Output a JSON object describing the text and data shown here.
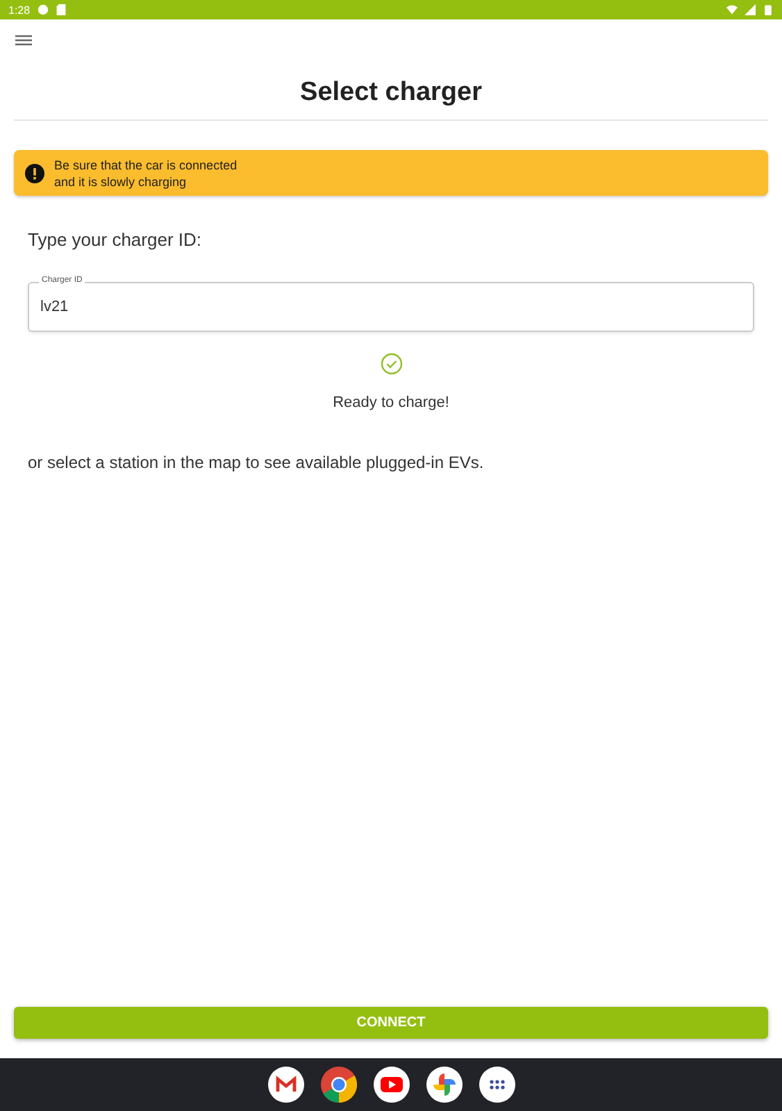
{
  "status_bar": {
    "time": "1:28"
  },
  "title": "Select charger",
  "alert": {
    "lines": [
      "Be sure that the car is connected",
      "and it is slowly charging"
    ]
  },
  "prompt": "Type your charger ID:",
  "charger_field": {
    "label": "Charger ID",
    "value": "lv21"
  },
  "status": {
    "ok": true,
    "text": "Ready to charge!"
  },
  "hint": "or select a station in the map to see available plugged-in EVs.",
  "connect_button": "CONNECT",
  "taskbar": [
    {
      "kind": "mail"
    },
    {
      "kind": "browser"
    },
    {
      "kind": "video"
    },
    {
      "kind": "photos"
    },
    {
      "kind": "apps"
    }
  ]
}
